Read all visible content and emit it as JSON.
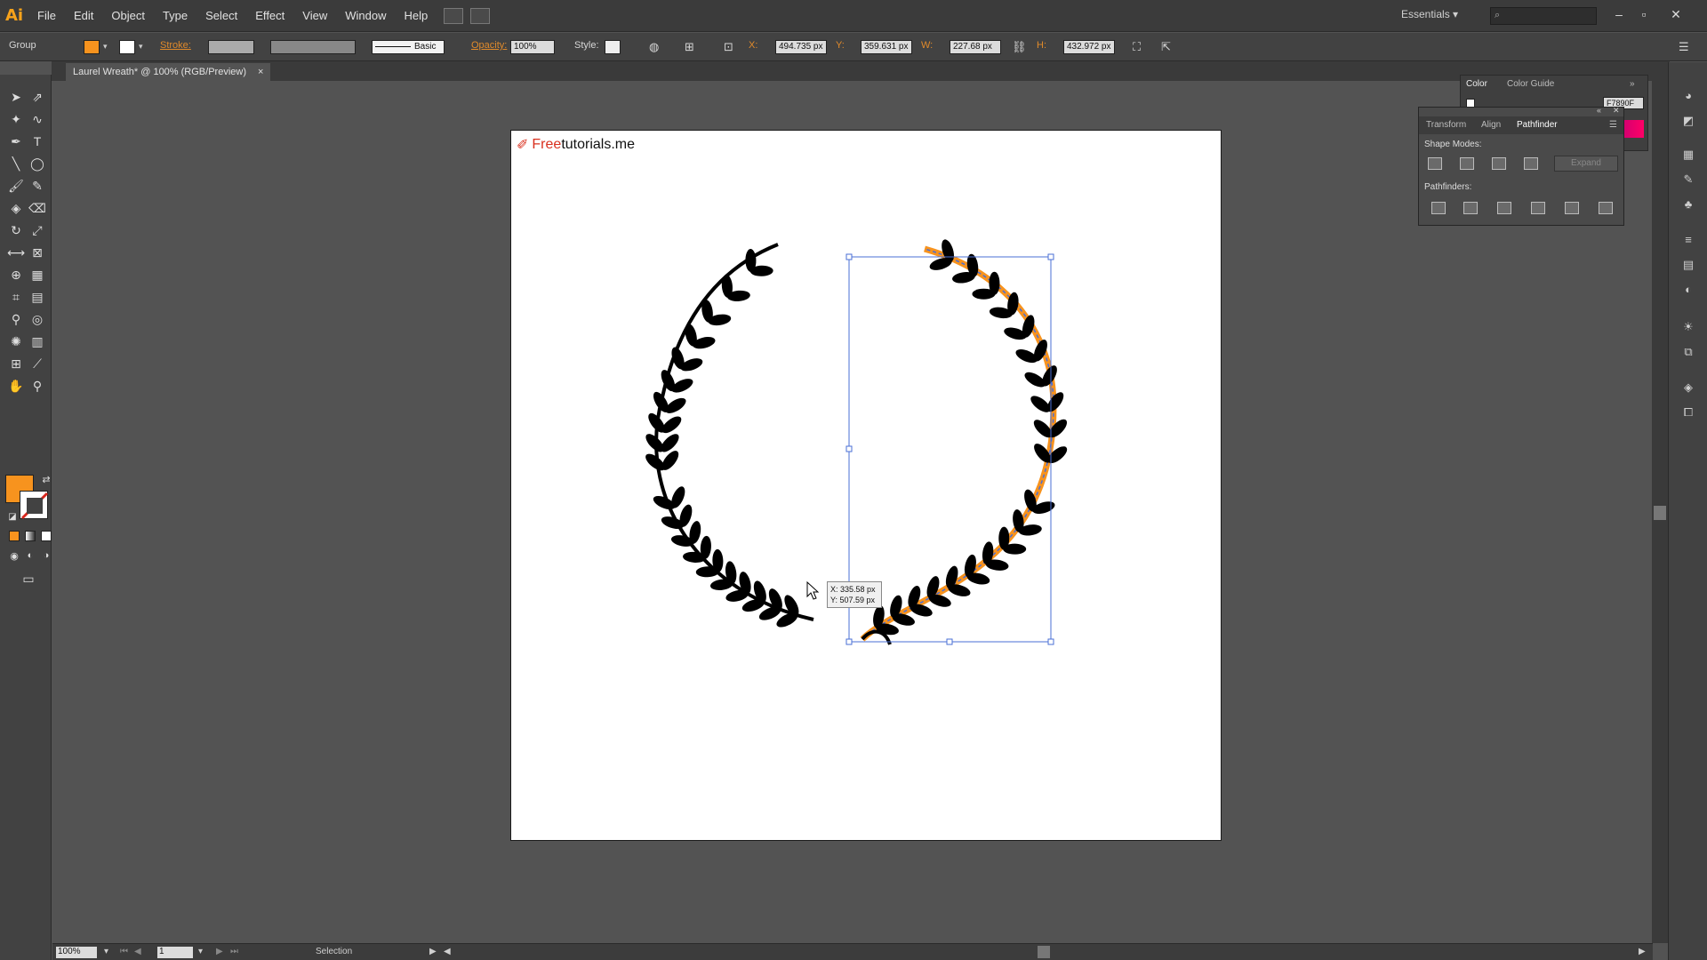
{
  "app": {
    "logo": "Ai"
  },
  "menu": [
    "File",
    "Edit",
    "Object",
    "Type",
    "Select",
    "Effect",
    "View",
    "Window",
    "Help"
  ],
  "workspace": {
    "label": "Essentials"
  },
  "control_bar": {
    "selection_type": "Group",
    "stroke_label": "Stroke:",
    "brush_label": "Basic",
    "opacity_label": "Opacity:",
    "opacity_value": "100%",
    "style_label": "Style:",
    "x_label": "X:",
    "x_value": "494.735 px",
    "y_label": "Y:",
    "y_value": "359.631 px",
    "w_label": "W:",
    "w_value": "227.68 px",
    "h_label": "H:",
    "h_value": "432.972 px"
  },
  "document": {
    "tab_title": "Laurel Wreath* @ 100% (RGB/Preview)",
    "close": "×"
  },
  "artboard": {
    "brand_red": "Free",
    "brand_black": "tutorials.me"
  },
  "tooltip": {
    "x": "X: 335.58 px",
    "y": "Y: 507.59 px"
  },
  "color_panel": {
    "tab1": "Color",
    "tab2": "Color Guide",
    "hex_value": "F7890F"
  },
  "pathfinder": {
    "tabs": [
      "Transform",
      "Align",
      "Pathfinder"
    ],
    "shape_modes_label": "Shape Modes:",
    "expand_label": "Expand",
    "pathfinders_label": "Pathfinders:"
  },
  "status_bar": {
    "zoom": "100%",
    "page": "1",
    "tool": "Selection"
  },
  "colors": {
    "fill": "#f7931e",
    "accent": "#f7931e",
    "selection": "#4a6fd6"
  }
}
